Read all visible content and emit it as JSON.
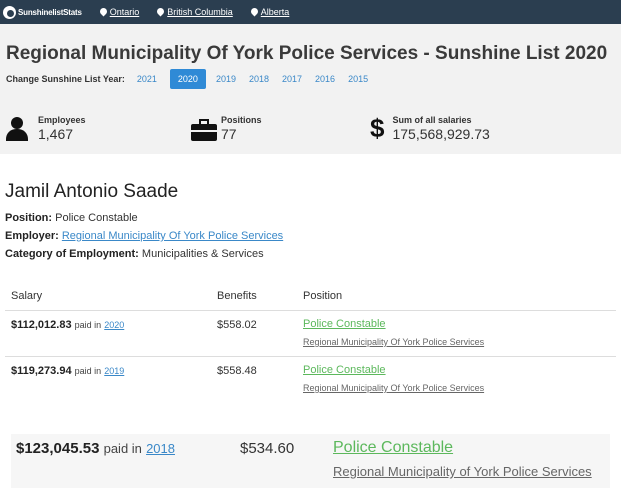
{
  "nav": {
    "brand": "SunshinelistStats",
    "links": [
      "Ontario",
      "British Columbia",
      "Alberta"
    ]
  },
  "header": {
    "title": "Regional Municipality Of York Police Services - Sunshine List 2020",
    "year_label": "Change Sunshine List Year:",
    "years": [
      "2021",
      "2020",
      "2019",
      "2018",
      "2017",
      "2016",
      "2015"
    ],
    "active_year": "2020"
  },
  "stats": {
    "employees_label": "Employees",
    "employees_value": "1,467",
    "positions_label": "Positions",
    "positions_value": "77",
    "salaries_label": "Sum of all salaries",
    "salaries_value": "175,568,929.73"
  },
  "person": {
    "name": "Jamil Antonio Saade",
    "position_label": "Position:",
    "position_value": "Police Constable",
    "employer_label": "Employer:",
    "employer_value": "Regional Municipality Of York Police Services",
    "category_label": "Category of Employment:",
    "category_value": "Municipalities & Services"
  },
  "table": {
    "headers": [
      "Salary",
      "Benefits",
      "Position"
    ],
    "rows": [
      {
        "salary": "$112,012.83",
        "paid_in": "paid in",
        "year": "2020",
        "benefits": "$558.02",
        "position": "Police Constable",
        "employer": "Regional Municipality Of York Police Services"
      },
      {
        "salary": "$119,273.94",
        "paid_in": "paid in",
        "year": "2019",
        "benefits": "$558.48",
        "position": "Police Constable",
        "employer": "Regional Municipality Of York Police Services"
      },
      {
        "salary": "$123,045.53",
        "paid_in": "paid in",
        "year": "2018",
        "benefits": "$534.60",
        "position": "Police Constable",
        "employer": "Regional Municipality of York Police Services"
      }
    ]
  },
  "colors": {
    "nav_bg": "#2b3e50",
    "accent": "#2f8ad6",
    "link": "#3a88c8",
    "position_link": "#5cb85c"
  }
}
